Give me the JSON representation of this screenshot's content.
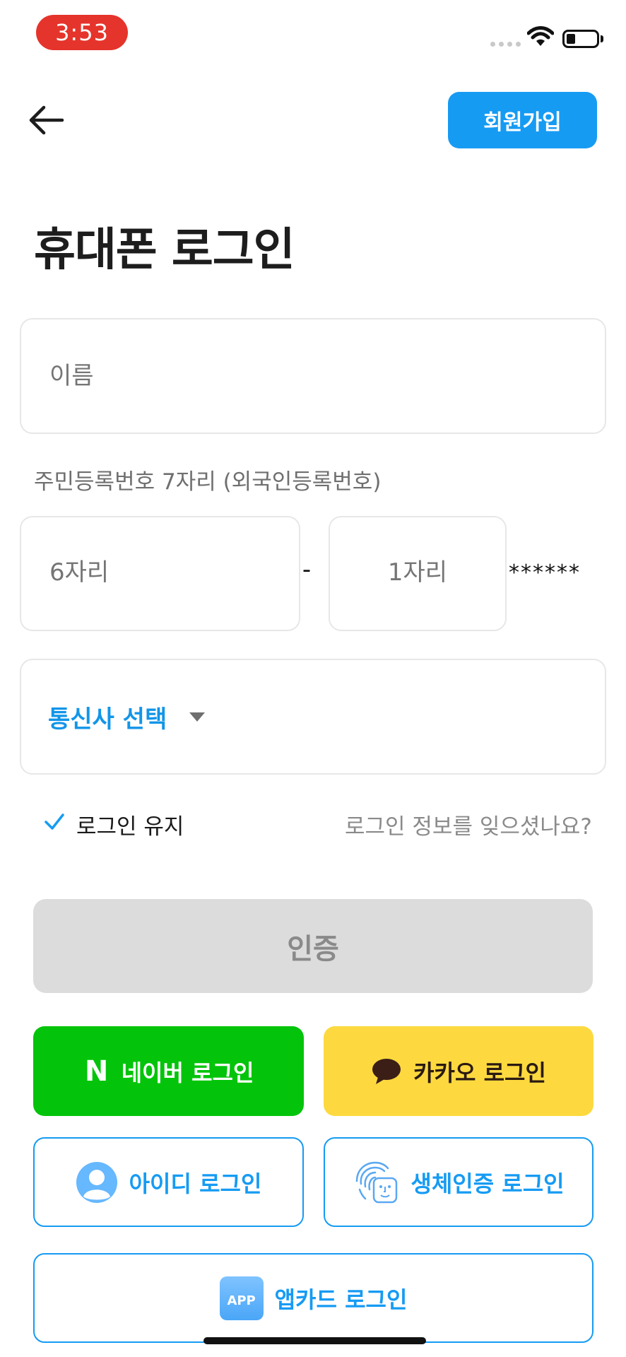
{
  "status_bar": {
    "time": "3:53"
  },
  "header": {
    "signup_label": "회원가입"
  },
  "title": "휴대폰 로그인",
  "form": {
    "name_placeholder": "이름",
    "rrn_label": "주민등록번호 7자리 (외국인등록번호)",
    "rrn_front_placeholder": "6자리",
    "rrn_dash": "-",
    "rrn_back_placeholder": "1자리",
    "rrn_mask": "******",
    "carrier_label": "통신사 선택"
  },
  "options": {
    "keep_login_label": "로그인 유지",
    "keep_login_checked": true,
    "forgot_label": "로그인 정보를 잊으셨나요?"
  },
  "buttons": {
    "auth": "인증",
    "naver": "네이버 로그인",
    "naver_letter": "N",
    "kakao": "카카오 로그인",
    "id_login": "아이디 로그인",
    "bio_login": "생체인증 로그인",
    "app_card": "앱카드 로그인",
    "app_badge": "APP"
  },
  "colors": {
    "accent": "#169bf3",
    "naver_green": "#03c40a",
    "kakao_yellow": "#fdd93f",
    "time_pill": "#e5342b",
    "disabled": "#dcdcdc"
  }
}
